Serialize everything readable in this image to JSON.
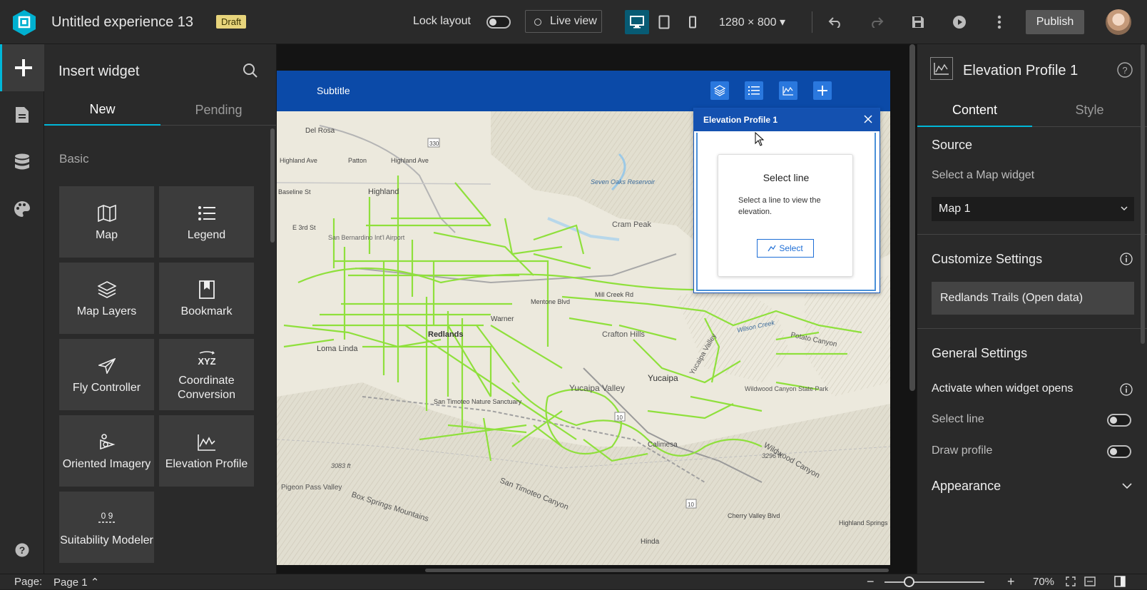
{
  "topbar": {
    "title": "Untitled experience 13",
    "draft_badge": "Draft",
    "lock_layout_label": "Lock layout",
    "live_view_label": "Live view",
    "resolution": "1280 × 800",
    "publish_label": "Publish"
  },
  "widget_panel": {
    "title": "Insert widget",
    "tabs": [
      "New",
      "Pending"
    ],
    "section": "Basic",
    "widgets": [
      {
        "label": "Map",
        "icon": "map-icon"
      },
      {
        "label": "Legend",
        "icon": "legend-icon"
      },
      {
        "label": "Map Layers",
        "icon": "layers-icon"
      },
      {
        "label": "Bookmark",
        "icon": "bookmark-icon"
      },
      {
        "label": "Fly Controller",
        "icon": "fly-icon"
      },
      {
        "label": "Coordinate Conversion",
        "icon": "xyz-icon"
      },
      {
        "label": "Oriented Imagery",
        "icon": "oriented-imagery-icon"
      },
      {
        "label": "Elevation Profile",
        "icon": "elevation-icon"
      },
      {
        "label": "Suitability Modeler",
        "icon": "suitability-icon"
      }
    ]
  },
  "canvas": {
    "subtitle": "Subtitle",
    "elevation_widget": {
      "title": "Elevation Profile 1",
      "card_title": "Select line",
      "card_text": "Select a line to view the elevation.",
      "select_button": "Select"
    },
    "map_labels": {
      "del_rosa": "Del Rosa",
      "highland_ave_1": "Highland Ave",
      "patton": "Patton",
      "highland_ave_2": "Highland Ave",
      "highland": "Highland",
      "baseline": "Baseline St",
      "e3rd": "E 3rd St",
      "sb_airport": "San Bernardino Int'l Airport",
      "seven_oaks": "Seven Oaks Reservoir",
      "cram_peak": "Cram Peak",
      "redlands": "Redlands",
      "loma_linda": "Loma Linda",
      "crafton_hills": "Crafton Hills",
      "yucaipa": "Yucaipa",
      "yucaipa_valley": "Yucaipa Valley",
      "calimesa": "Calimesa",
      "san_timoteo_canyon": "San Timoteo Canyon",
      "box_springs": "Box Springs Mountains",
      "pigeon_pass": "Pigeon Pass Valley",
      "cherry_valley": "Cherry Valley Blvd",
      "hinda": "Hinda",
      "wildwood_canyon": "Wildwood Canyon",
      "wildwood_sp": "Wildwood Canyon State Park",
      "potato_canyon": "Potato Canyon",
      "wilson_creek": "Wilson Creek",
      "highland_springs": "Highland Springs",
      "yucaipa_valley_2": "Yucaipa Valley",
      "mill_creek": "Mill Creek Rd",
      "mentone": "Mentone Blvd",
      "warner": "Warner",
      "timoteo_ns": "San Timoteo Nature Sanctuary",
      "route_330": "330",
      "route_10a": "10",
      "route_10b": "10",
      "elev_3083": "3083 ft",
      "elev_3296": "3296 ft"
    }
  },
  "props": {
    "title": "Elevation Profile 1",
    "tabs": [
      "Content",
      "Style"
    ],
    "source_header": "Source",
    "select_map_label": "Select a Map widget",
    "map_select_value": "Map 1",
    "customize_header": "Customize Settings",
    "datasource": "Redlands Trails (Open data)",
    "general_header": "General Settings",
    "activate_label": "Activate when widget opens",
    "select_line_label": "Select line",
    "draw_profile_label": "Draw profile",
    "appearance_header": "Appearance"
  },
  "statusbar": {
    "page_label": "Page:",
    "page_value": "Page 1",
    "zoom": "70%"
  },
  "colors": {
    "accent": "#00b7d8",
    "header_blue": "#0b4aa8",
    "trails": "#8fe03c",
    "draft": "#e7d47b"
  }
}
